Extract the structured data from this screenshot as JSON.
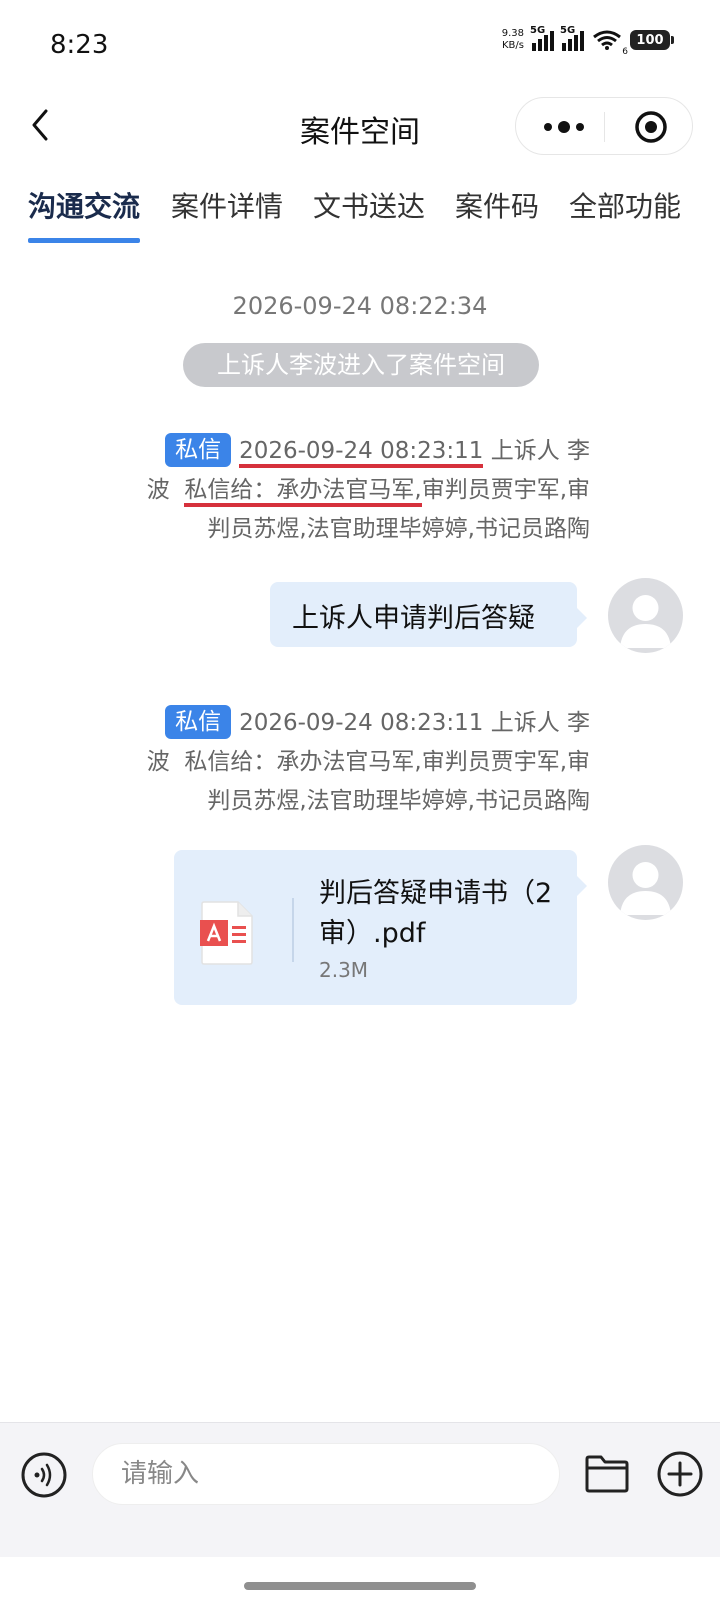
{
  "status_bar": {
    "time": "8:23",
    "net_speed_value": "9.38",
    "net_speed_unit": "KB/s",
    "sim1_label": "5G",
    "sim2_label": "5G",
    "wifi_badge": "6",
    "battery": "100"
  },
  "header": {
    "title": "案件空间",
    "icons": [
      "back-icon",
      "more-dots-icon",
      "close-target-icon"
    ]
  },
  "tabs": [
    {
      "label": "沟通交流",
      "active": true
    },
    {
      "label": "案件详情",
      "active": false
    },
    {
      "label": "文书送达",
      "active": false
    },
    {
      "label": "案件码",
      "active": false
    },
    {
      "label": "全部功能",
      "active": false
    }
  ],
  "chat": {
    "system_time": "2026-09-24 08:22:34",
    "system_notice": "上诉人李波进入了案件空间",
    "messages": [
      {
        "badge": "私信",
        "timestamp": "2026-09-24 08:23:11",
        "sender_role": "上诉人",
        "sender_name": "李波",
        "recipients_prefix": "私信给：承办法官马军,",
        "recipients_rest": "审判员贾宇军,审判员苏煜,法官助理毕婷婷,书记员路陶",
        "content": "上诉人申请判后答疑"
      },
      {
        "badge": "私信",
        "timestamp": "2026-09-24 08:23:11",
        "sender_role": "上诉人",
        "sender_name": "李波",
        "recipients_prefix": "私信给：承办法官马军,",
        "recipients_rest": "审判员贾宇军,审判员苏煜,法官助理毕婷婷,书记员路陶",
        "file": {
          "name": "判后答疑申请书（2审）.pdf",
          "size": "2.3M",
          "icon": "pdf-file-icon"
        }
      }
    ]
  },
  "input_bar": {
    "placeholder": "请输入",
    "icons": [
      "voice-icon",
      "folder-icon",
      "add-circle-icon"
    ]
  },
  "colors": {
    "accent": "#3b84e8",
    "bubble": "#e3eefb",
    "underline": "#d6313c",
    "notice_bg": "#c8c9cd",
    "pdf_red": "#e9504f"
  }
}
